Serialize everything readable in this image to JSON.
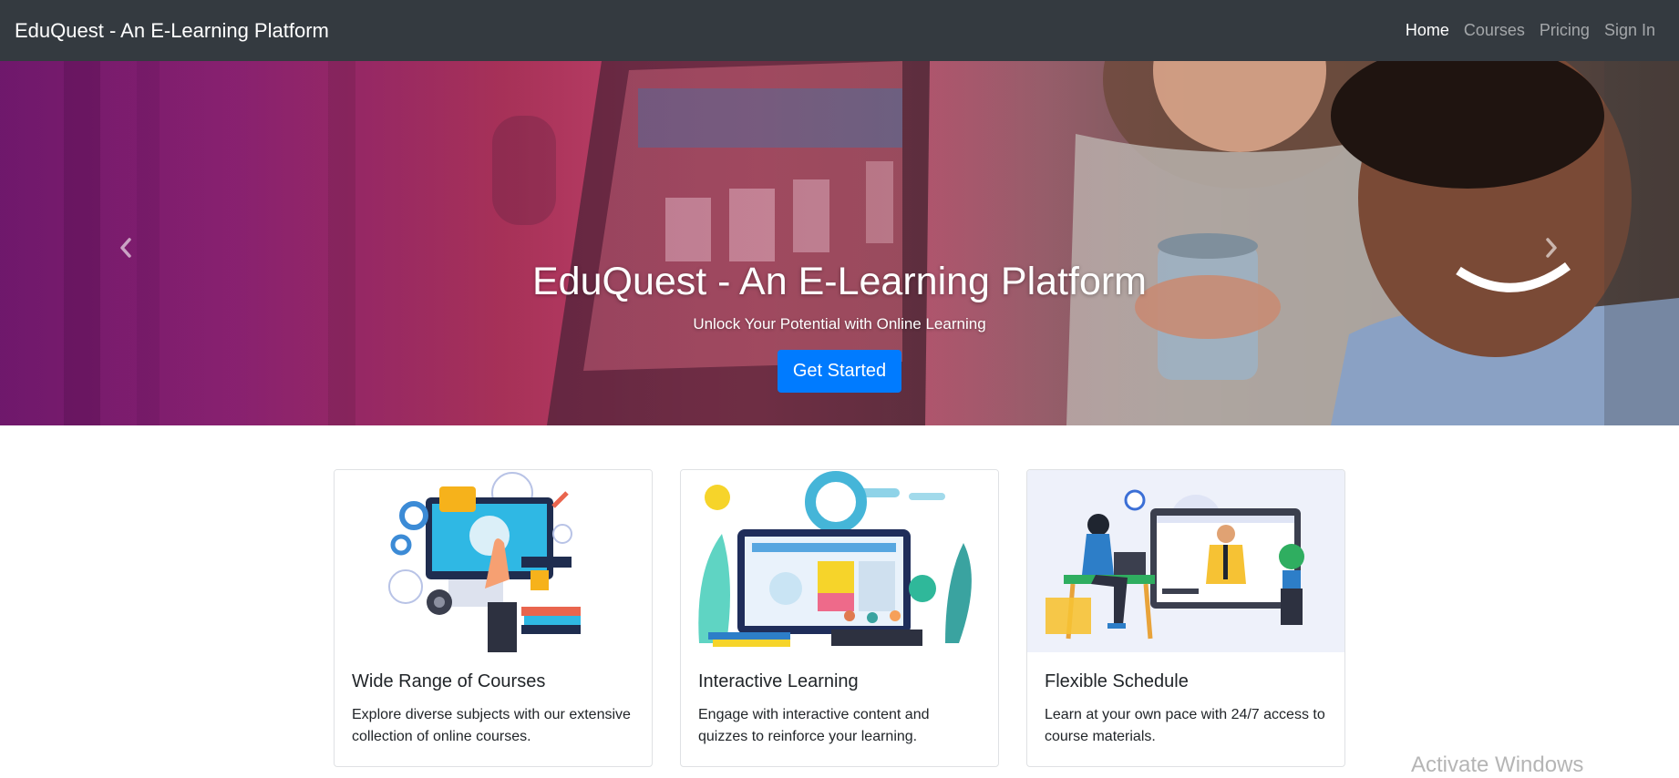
{
  "navbar": {
    "brand": "EduQuest - An E-Learning Platform",
    "links": [
      {
        "label": "Home",
        "active": true
      },
      {
        "label": "Courses",
        "active": false
      },
      {
        "label": "Pricing",
        "active": false
      },
      {
        "label": "Sign In",
        "active": false
      }
    ]
  },
  "hero": {
    "title": "EduQuest - An E-Learning Platform",
    "subtitle": "Unlock Your Potential with Online Learning",
    "cta_label": "Get Started",
    "prev_icon": "chevron-left-icon",
    "next_icon": "chevron-right-icon"
  },
  "features": [
    {
      "title": "Wide Range of Courses",
      "text": "Explore diverse subjects with our extensive collection of online courses."
    },
    {
      "title": "Interactive Learning",
      "text": "Engage with interactive content and quizzes to reinforce your learning."
    },
    {
      "title": "Flexible Schedule",
      "text": "Learn at your own pace with 24/7 access to course materials."
    }
  ],
  "watermark": "Activate Windows",
  "colors": {
    "navbar_bg": "#343a40",
    "primary": "#007bff"
  }
}
